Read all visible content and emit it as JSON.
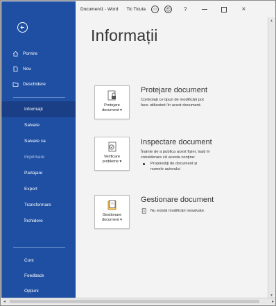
{
  "titlebar": {
    "document": "Document1 - Word",
    "user": "Tic Ticuta",
    "smiley_icon": "smiley-icon",
    "frown_icon": "frown-icon",
    "help": "?",
    "close": "×"
  },
  "sidebar": {
    "top_items": [
      {
        "label": "Pornire",
        "icon": "home-icon"
      },
      {
        "label": "Nou",
        "icon": "new-document-icon"
      },
      {
        "label": "Deschidere",
        "icon": "folder-open-icon"
      }
    ],
    "main_items": [
      {
        "label": "Informații",
        "active": true
      },
      {
        "label": "Salvare"
      },
      {
        "label": "Salvare ca"
      },
      {
        "label": "Imprimare",
        "dim": true
      },
      {
        "label": "Partajare"
      },
      {
        "label": "Export"
      },
      {
        "label": "Transformare"
      },
      {
        "label": "Închidere"
      }
    ],
    "bottom_items": [
      {
        "label": "Cont"
      },
      {
        "label": "Feedback"
      },
      {
        "label": "Opțiuni"
      }
    ]
  },
  "main": {
    "title": "Informații",
    "protect": {
      "button_line1": "Protejare",
      "button_line2": "document ▾",
      "title": "Protejare document",
      "description_line1": "Controlați ce tipuri de modificări pot",
      "description_line2": "face utilizatorii în acest document."
    },
    "inspect": {
      "button_line1": "Verificare",
      "button_line2": "probleme ▾",
      "title": "Inspectare document",
      "description_line1": "Înainte de a publica acest fișier, luați în",
      "description_line2": "considerare că acesta conține:",
      "bullet_line1": "Proprietăți de document și",
      "bullet_line2": "numele autorului"
    },
    "manage": {
      "button_line1": "Gestionare",
      "button_line2": "document ▾",
      "title": "Gestionare document",
      "status": "Nu există modificări nesalvate."
    }
  },
  "colors": {
    "sidebar": "#1f4fa3",
    "sidebar_active": "#1a3f86",
    "background": "#f3f3f3"
  }
}
